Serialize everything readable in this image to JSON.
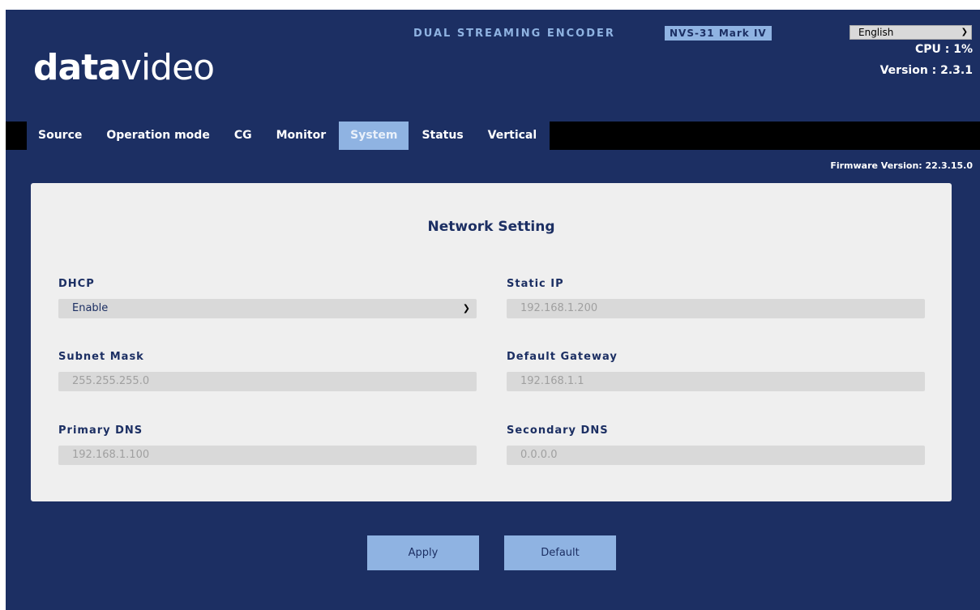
{
  "header": {
    "logo_bold": "data",
    "logo_light": "video",
    "product_line": "DUAL STREAMING ENCODER",
    "model": "NVS-31 Mark IV",
    "language": "English",
    "cpu": "CPU  : 1%",
    "version": "Version : 2.3.1"
  },
  "nav": {
    "tabs": [
      {
        "label": "Source"
      },
      {
        "label": "Operation mode"
      },
      {
        "label": "CG"
      },
      {
        "label": "Monitor"
      },
      {
        "label": "System",
        "active": true
      },
      {
        "label": "Status"
      },
      {
        "label": "Vertical"
      }
    ]
  },
  "firmware": "Firmware Version: 22.3.15.0",
  "panel": {
    "title": "Network Setting",
    "dhcp": {
      "label": "DHCP",
      "value": "Enable"
    },
    "static_ip": {
      "label": "Static IP",
      "value": "192.168.1.200"
    },
    "subnet_mask": {
      "label": "Subnet Mask",
      "value": "255.255.255.0"
    },
    "default_gateway": {
      "label": "Default Gateway",
      "value": "192.168.1.1"
    },
    "primary_dns": {
      "label": "Primary DNS",
      "value": "192.168.1.100"
    },
    "secondary_dns": {
      "label": "Secondary DNS",
      "value": "0.0.0.0"
    }
  },
  "buttons": {
    "apply": "Apply",
    "default": "Default"
  },
  "colors": {
    "background": "#1c2f63",
    "accent": "#8fb3e2",
    "panel": "#efefef",
    "nav_bar": "#000000"
  }
}
